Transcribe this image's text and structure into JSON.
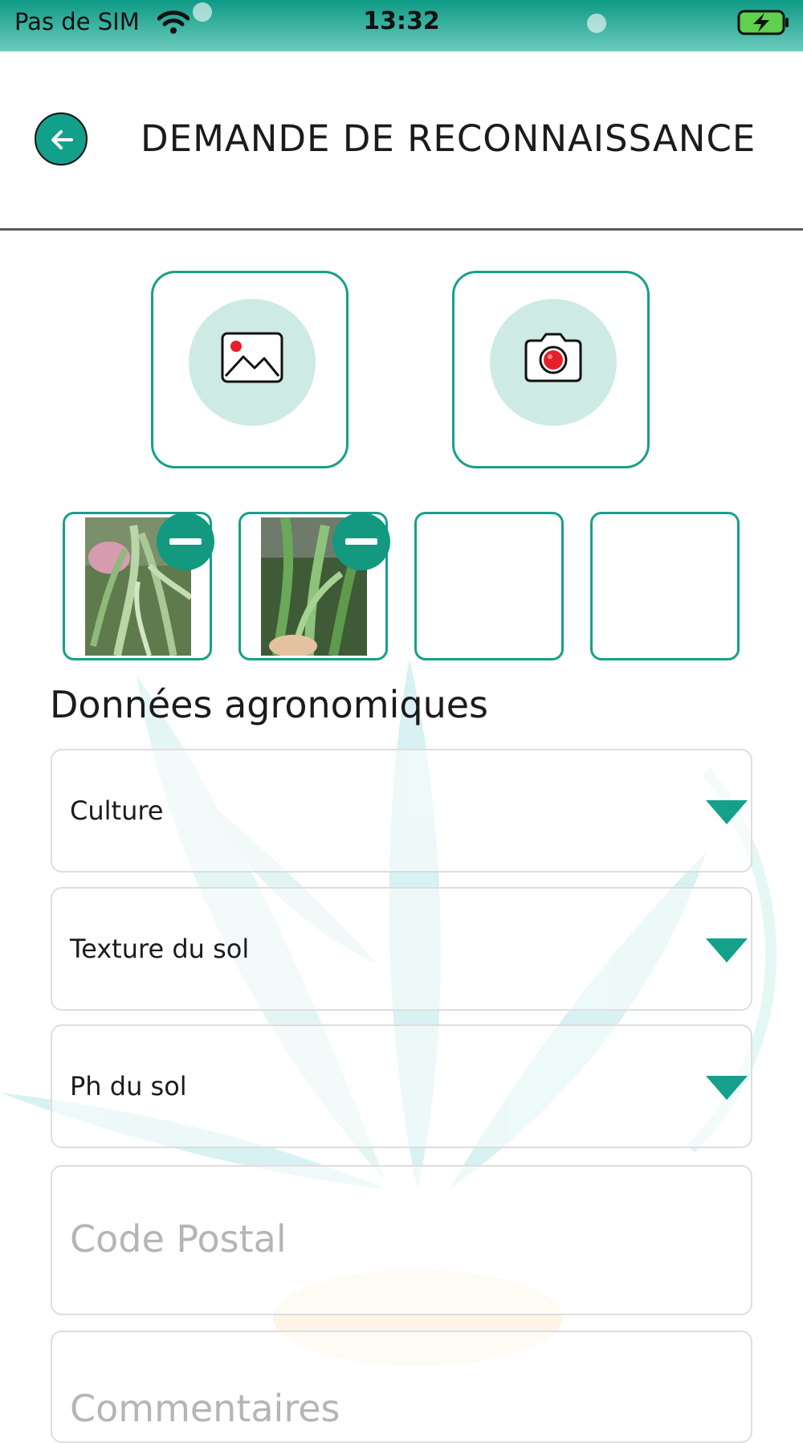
{
  "status_bar": {
    "carrier": "Pas de SIM",
    "time": "13:32"
  },
  "header": {
    "title": "DEMANDE DE RECONNAISSANCE",
    "back_icon": "arrow-left-icon"
  },
  "pickers": {
    "gallery_icon": "image-gallery-icon",
    "camera_icon": "camera-icon"
  },
  "thumbnails": [
    {
      "filled": true
    },
    {
      "filled": true
    },
    {
      "filled": false
    },
    {
      "filled": false
    }
  ],
  "form": {
    "section_title": "Données agronomiques",
    "culture_label": "Culture",
    "texture_label": "Texture du sol",
    "ph_label": "Ph du sol",
    "postal_placeholder": "Code Postal",
    "comments_placeholder": "Commentaires"
  },
  "colors": {
    "accent": "#13a08b",
    "accent_light": "#cdeae4",
    "camera_red": "#e5202a"
  }
}
